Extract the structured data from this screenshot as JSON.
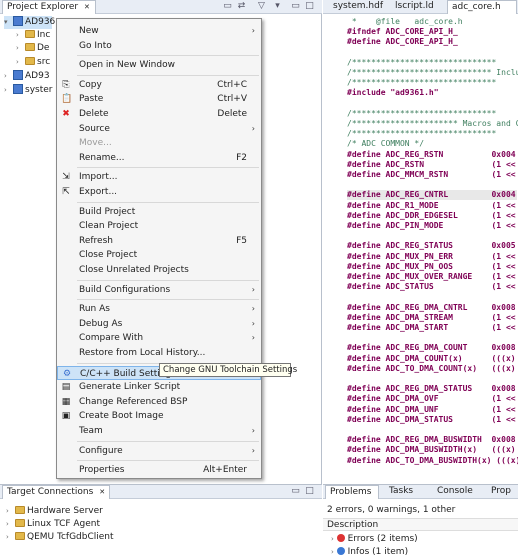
{
  "project_explorer": {
    "tab_label": "Project Explorer",
    "close": "✕",
    "tree": [
      {
        "label": "AD936",
        "indent": 0,
        "expanded": true,
        "selected": true
      },
      {
        "label": "Inc",
        "indent": 1,
        "expanded": false
      },
      {
        "label": "De",
        "indent": 1,
        "expanded": false
      },
      {
        "label": "src",
        "indent": 1,
        "expanded": false
      },
      {
        "label": "AD93",
        "indent": 0,
        "expanded": false
      },
      {
        "label": "syster",
        "indent": 0,
        "expanded": false
      }
    ]
  },
  "editor": {
    "tabs": [
      "system.hdf",
      "lscript.ld",
      "adc_core.h"
    ],
    "lines": [
      {
        "t": " *    @file   adc_core.h",
        "c": "cm"
      },
      {
        "t": "#ifndef ADC_CORE_API_H_",
        "c": ""
      },
      {
        "t": "#define ADC_CORE_API_H_",
        "c": ""
      },
      {
        "t": "",
        "c": ""
      },
      {
        "t": "/******************************",
        "c": "cm"
      },
      {
        "t": "/***************************** Inclu",
        "c": "cm"
      },
      {
        "t": "/******************************",
        "c": "cm"
      },
      {
        "t": "#include \"ad9361.h\"",
        "c": "inc"
      },
      {
        "t": "",
        "c": ""
      },
      {
        "t": "/******************************",
        "c": "cm"
      },
      {
        "t": "/********************** Macros and Co",
        "c": "cm"
      },
      {
        "t": "/******************************",
        "c": "cm"
      },
      {
        "t": "/* ADC COMMON */",
        "c": "cm"
      },
      {
        "t": "#define ADC_REG_RSTN          0x004",
        "c": ""
      },
      {
        "t": "#define ADC_RSTN              (1 <<",
        "c": ""
      },
      {
        "t": "#define ADC_MMCM_RSTN         (1 <<",
        "c": ""
      },
      {
        "t": "",
        "c": ""
      },
      {
        "t": "#define ADC_REG_CNTRL         0x004",
        "c": "hl"
      },
      {
        "t": "#define ADC_R1_MODE           (1 <<",
        "c": ""
      },
      {
        "t": "#define ADC_DDR_EDGESEL       (1 <<",
        "c": ""
      },
      {
        "t": "#define ADC_PIN_MODE          (1 <<",
        "c": ""
      },
      {
        "t": "",
        "c": ""
      },
      {
        "t": "#define ADC_REG_STATUS        0x005",
        "c": ""
      },
      {
        "t": "#define ADC_MUX_PN_ERR        (1 <<",
        "c": ""
      },
      {
        "t": "#define ADC_MUX_PN_OOS        (1 <<",
        "c": ""
      },
      {
        "t": "#define ADC_MUX_OVER_RANGE    (1 <<",
        "c": ""
      },
      {
        "t": "#define ADC_STATUS            (1 <<",
        "c": ""
      },
      {
        "t": "",
        "c": ""
      },
      {
        "t": "#define ADC_REG_DMA_CNTRL     0x008",
        "c": ""
      },
      {
        "t": "#define ADC_DMA_STREAM        (1 <<",
        "c": ""
      },
      {
        "t": "#define ADC_DMA_START         (1 <<",
        "c": ""
      },
      {
        "t": "",
        "c": ""
      },
      {
        "t": "#define ADC_REG_DMA_COUNT     0x008",
        "c": ""
      },
      {
        "t": "#define ADC_DMA_COUNT(x)      (((x)",
        "c": ""
      },
      {
        "t": "#define ADC_TO_DMA_COUNT(x)   (((x)",
        "c": ""
      },
      {
        "t": "",
        "c": ""
      },
      {
        "t": "#define ADC_REG_DMA_STATUS    0x008",
        "c": ""
      },
      {
        "t": "#define ADC_DMA_OVF           (1 <<",
        "c": ""
      },
      {
        "t": "#define ADC_DMA_UNF           (1 <<",
        "c": ""
      },
      {
        "t": "#define ADC_DMA_STATUS        (1 <<",
        "c": ""
      },
      {
        "t": "",
        "c": ""
      },
      {
        "t": "#define ADC_REG_DMA_BUSWIDTH  0x008",
        "c": ""
      },
      {
        "t": "#define ADC_DMA_BUSWIDTH(x)   (((x)",
        "c": ""
      },
      {
        "t": "#define ADC_TO_DMA_BUSWIDTH(x) (((x)",
        "c": ""
      }
    ]
  },
  "context_menu": {
    "items": [
      {
        "label": "New",
        "sub": true
      },
      {
        "label": "Go Into"
      },
      {
        "sep": true
      },
      {
        "label": "Open in New Window"
      },
      {
        "sep": true
      },
      {
        "label": "Copy",
        "shortcut": "Ctrl+C",
        "icon": "copy"
      },
      {
        "label": "Paste",
        "shortcut": "Ctrl+V",
        "icon": "paste"
      },
      {
        "label": "Delete",
        "shortcut": "Delete",
        "icon": "delete"
      },
      {
        "label": "Source",
        "sub": true
      },
      {
        "label": "Move...",
        "disabled": true
      },
      {
        "label": "Rename...",
        "shortcut": "F2"
      },
      {
        "sep": true
      },
      {
        "label": "Import...",
        "icon": "import"
      },
      {
        "label": "Export...",
        "icon": "export"
      },
      {
        "sep": true
      },
      {
        "label": "Build Project"
      },
      {
        "label": "Clean Project"
      },
      {
        "label": "Refresh",
        "shortcut": "F5"
      },
      {
        "label": "Close Project"
      },
      {
        "label": "Close Unrelated Projects"
      },
      {
        "sep": true
      },
      {
        "label": "Build Configurations",
        "sub": true
      },
      {
        "sep": true
      },
      {
        "label": "Run As",
        "sub": true
      },
      {
        "label": "Debug As",
        "sub": true
      },
      {
        "label": "Compare With",
        "sub": true
      },
      {
        "label": "Restore from Local History..."
      },
      {
        "sep": true
      },
      {
        "label": "C/C++ Build Settings",
        "highlight": true,
        "icon": "settings"
      },
      {
        "label": "Generate Linker Script",
        "icon": "gen"
      },
      {
        "label": "Change Referenced BSP",
        "icon": "bsp"
      },
      {
        "label": "Create Boot Image",
        "icon": "boot"
      },
      {
        "label": "Team",
        "sub": true
      },
      {
        "sep": true
      },
      {
        "label": "Configure",
        "sub": true
      },
      {
        "sep": true
      },
      {
        "label": "Properties",
        "shortcut": "Alt+Enter"
      }
    ],
    "tooltip": "Change GNU Toolchain Settings"
  },
  "target_connections": {
    "tab_label": "Target Connections",
    "close": "✕",
    "items": [
      "Hardware Server",
      "Linux TCF Agent",
      "QEMU TcfGdbClient"
    ]
  },
  "problems": {
    "tabs": [
      "Problems",
      "Tasks",
      "Console",
      "Prop"
    ],
    "summary": "2 errors, 0 warnings, 1 other",
    "header": "Description",
    "rows": [
      "Errors (2 items)",
      "Infos (1 item)"
    ]
  },
  "colors": {
    "selection": "#cde3f7",
    "keyword": "#7f0055",
    "comment": "#3f7f5f",
    "string": "#2a00ff"
  }
}
